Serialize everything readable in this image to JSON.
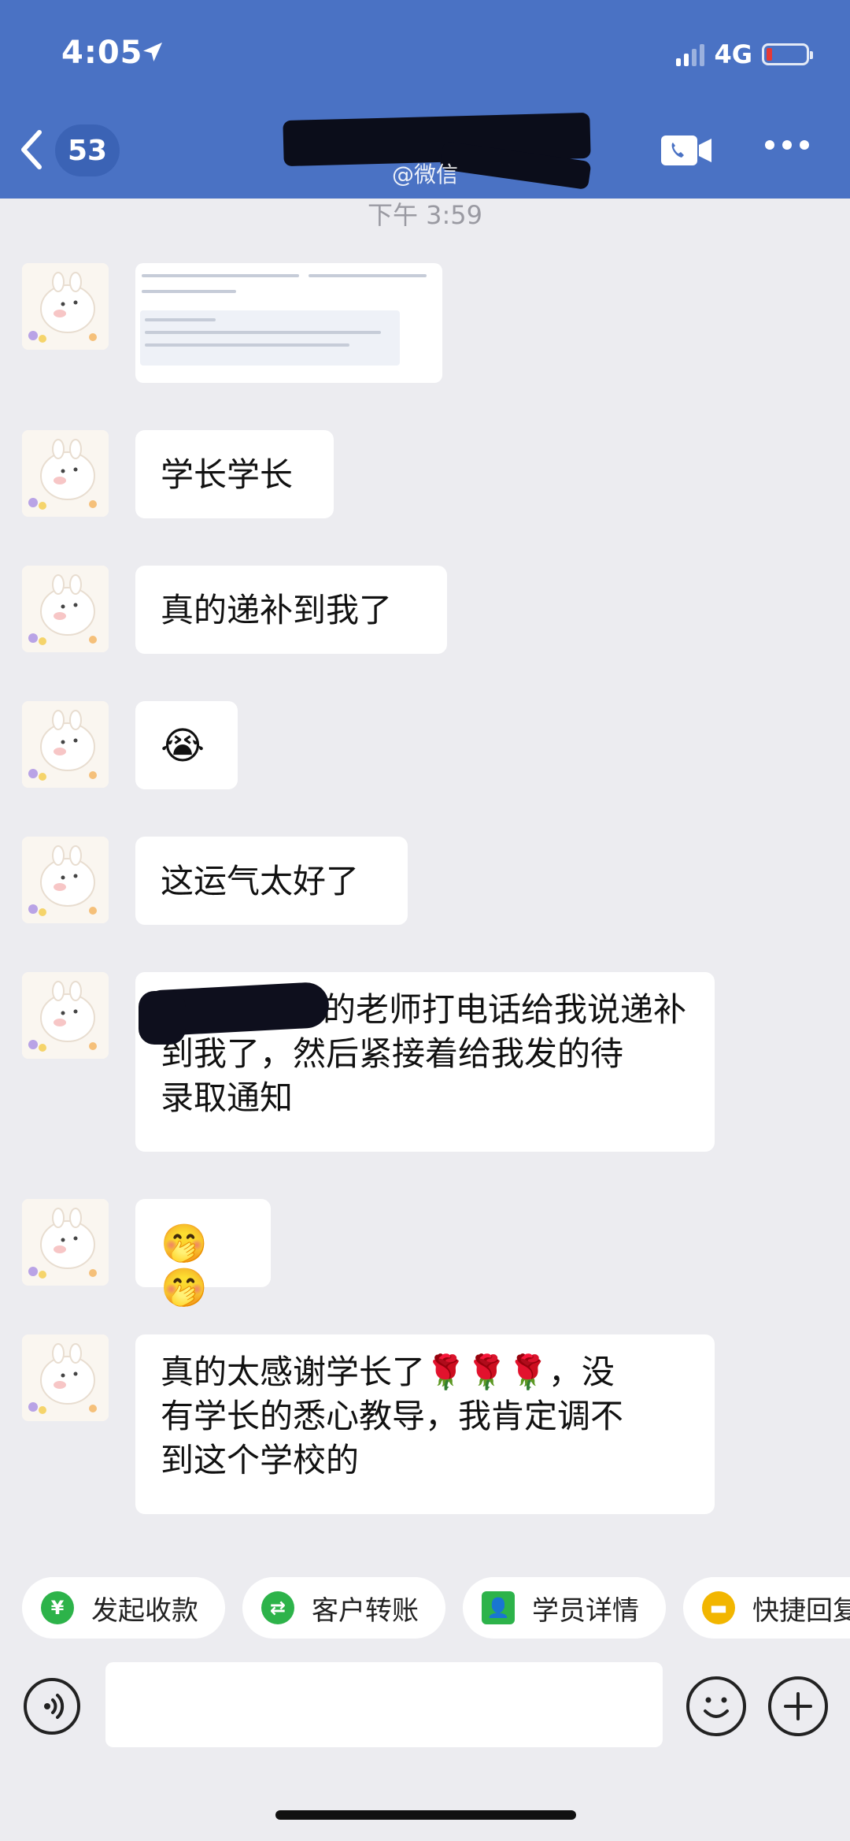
{
  "status_bar": {
    "time": "4:05",
    "network": "4G"
  },
  "header": {
    "unread_count": "53",
    "subtitle": "@微信"
  },
  "chat": {
    "timestamp": "下午 3:59",
    "messages": [
      {
        "type": "image"
      },
      {
        "type": "text",
        "text": "学长学长"
      },
      {
        "type": "text",
        "text": "真的递补到我了"
      },
      {
        "type": "emoji",
        "text": "😭"
      },
      {
        "type": "text",
        "text": "这运气太好了"
      },
      {
        "type": "text",
        "lines": [
          "的老师打电话给我说递补",
          "到我了，然后紧接着给我发的待",
          "录取通知"
        ]
      },
      {
        "type": "emoji",
        "text": "🤭🤭"
      },
      {
        "type": "text",
        "lines": [
          "真的太感谢学长了🌹🌹🌹，没",
          "有学长的悉心教导，我肯定调不",
          "到这个学校的"
        ]
      }
    ]
  },
  "quick_actions": [
    {
      "label": "发起收款",
      "icon": "yen-icon",
      "color": "#2db34a"
    },
    {
      "label": "客户转账",
      "icon": "transfer-icon",
      "color": "#2db34a"
    },
    {
      "label": "学员详情",
      "icon": "user-icon",
      "color": "#2db34a"
    },
    {
      "label": "快捷回复",
      "icon": "chat-icon",
      "color": "#f2b600"
    }
  ],
  "input": {
    "placeholder": ""
  }
}
